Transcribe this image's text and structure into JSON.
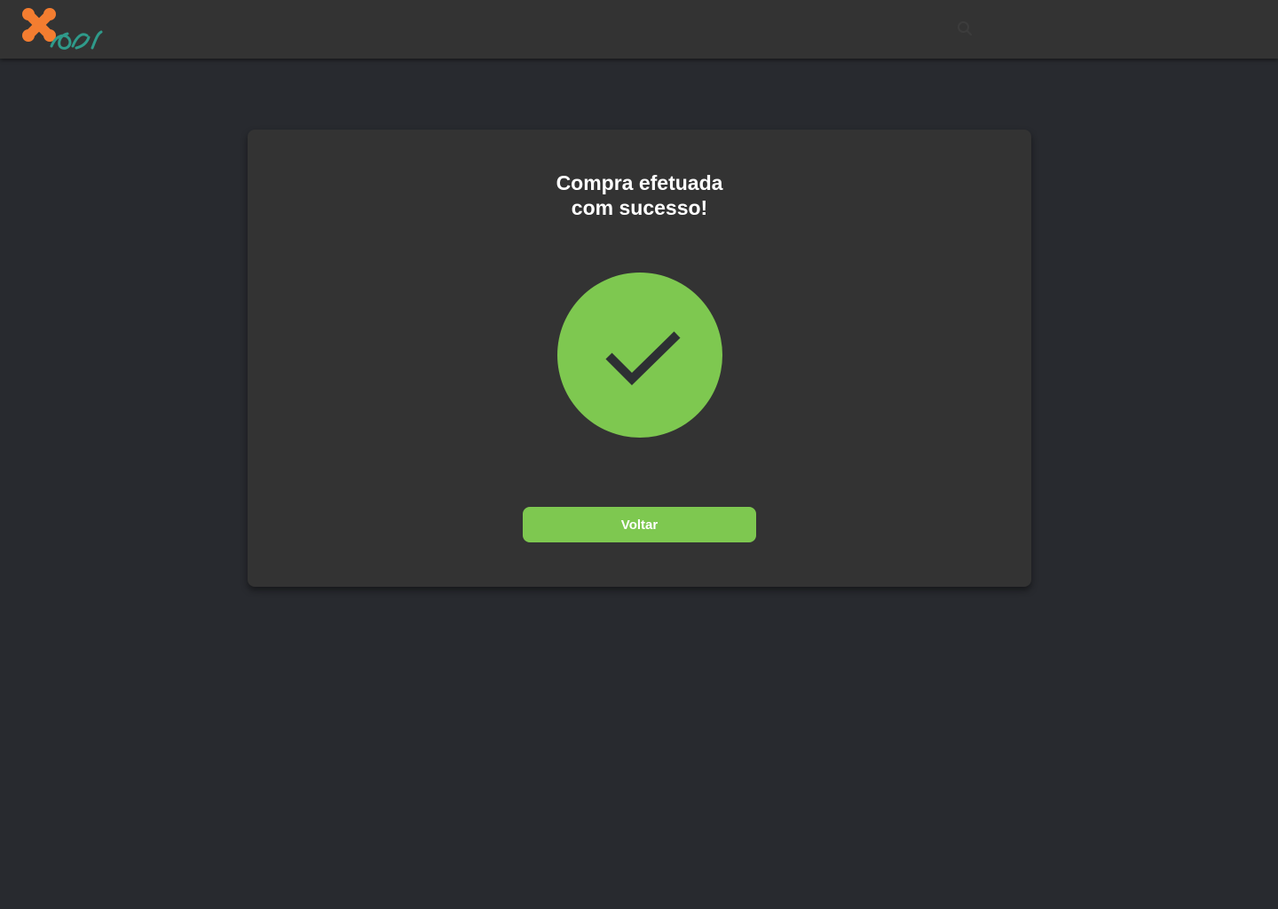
{
  "header": {
    "logo_name": "xos-logo",
    "search_icon": "search-icon"
  },
  "confirmation": {
    "title_line1": "Compra efetuada",
    "title_line2": "com sucesso!",
    "status_icon": "check-circle-icon",
    "back_label": "Voltar"
  },
  "colors": {
    "background": "#282a2f",
    "surface": "#333333",
    "accent_green": "#7ec850",
    "logo_orange": "#f47d30",
    "logo_teal": "#2f9a8a",
    "text": "#ffffff"
  }
}
